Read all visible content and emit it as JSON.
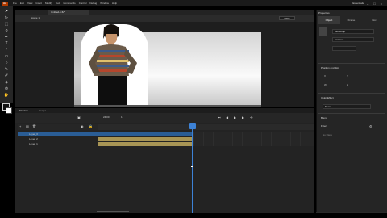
{
  "app": {
    "logo": "An",
    "title": "Untitled-1.fla @ 100%"
  },
  "menu": [
    "File",
    "Edit",
    "View",
    "Insert",
    "Modify",
    "Text",
    "Commands",
    "Control",
    "Debug",
    "Window",
    "Help"
  ],
  "workspace": "Essentials",
  "document_tab": "Untitled-1.fla*",
  "scene": "Scene 1",
  "zoom": "100%",
  "tools": [
    "pointer-icon",
    "subselect-icon",
    "free-transform-icon",
    "lasso-icon",
    "pen-icon",
    "text-icon",
    "line-icon",
    "rectangle-icon",
    "oval-icon",
    "pencil-icon",
    "brush-icon",
    "bone-icon",
    "paint-bucket-icon",
    "eyedropper-icon",
    "eraser-icon",
    "hand-icon",
    "zoom-icon"
  ],
  "properties": {
    "title": "Properties",
    "tabs": [
      "Object",
      "Frame",
      "Doc"
    ],
    "active_tab": "Object",
    "type": "MovieClip",
    "instance_name": "Instance",
    "section_position": "Position and Size",
    "section_color": "Color Effect",
    "color_style": "None",
    "section_blend": "Blend",
    "section_filters": "Filters",
    "filters_empty": "No filters"
  },
  "timeline": {
    "tabs": [
      "Timeline",
      "Output"
    ],
    "fps": "24.00",
    "frame": "1",
    "layers": [
      {
        "name": "Layer_3",
        "selected": true
      },
      {
        "name": "Layer_2",
        "selected": false
      },
      {
        "name": "Layer_1",
        "selected": false
      }
    ]
  },
  "colors": {
    "accent": "#3d82d6",
    "frame_fill": "#a89555",
    "selected_layer": "#2a5d95"
  }
}
